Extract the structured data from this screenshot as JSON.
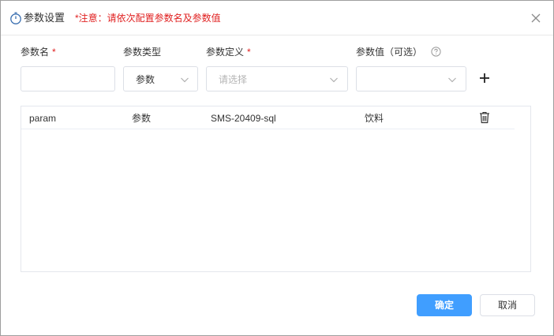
{
  "header": {
    "title": "参数设置",
    "notice": "*注意：请依次配置参数名及参数值",
    "title_icon": "stopwatch-icon",
    "close_icon": "close-icon"
  },
  "fields": {
    "param_name": {
      "label": "参数名",
      "required_mark": "*",
      "value": ""
    },
    "param_type": {
      "label": "参数类型",
      "value": "参数"
    },
    "param_def": {
      "label": "参数定义",
      "required_mark": "*",
      "placeholder": "请选择"
    },
    "param_value": {
      "label": "参数值（可选）",
      "help_icon": "question-circle-icon",
      "value": ""
    },
    "add_icon": "plus-icon"
  },
  "table": {
    "rows": [
      {
        "name": "param",
        "type": "参数",
        "definition": "SMS-20409-sql",
        "value": "饮料",
        "action_icon": "trash-icon"
      }
    ]
  },
  "footer": {
    "confirm_label": "确定",
    "cancel_label": "取消"
  },
  "colors": {
    "primary": "#409eff",
    "required": "#e02020",
    "border": "#dcdfe6"
  }
}
